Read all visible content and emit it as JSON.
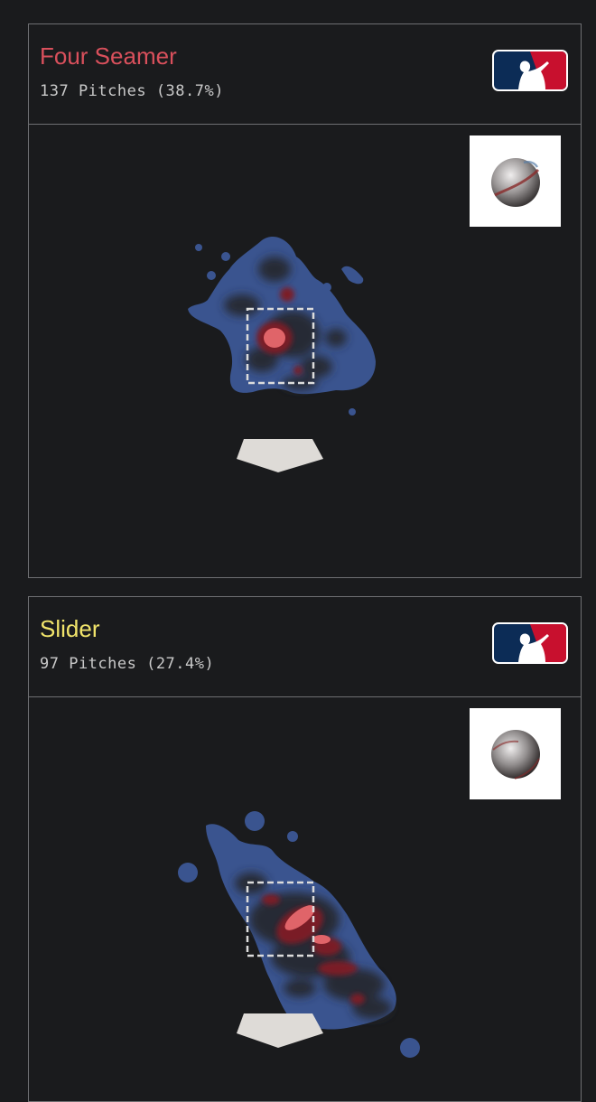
{
  "cards": [
    {
      "pitch_name": "Four Seamer",
      "pitch_count_text": "137 Pitches (38.7%)",
      "name_color": "#d9505c",
      "logo_icon": "mlb-logo-icon",
      "ball_icon": "four-seam-ball-icon"
    },
    {
      "pitch_name": "Slider",
      "pitch_count_text": "97 Pitches (27.4%)",
      "name_color": "#f2e56b",
      "logo_icon": "mlb-logo-icon",
      "ball_icon": "slider-ball-icon"
    }
  ],
  "colors": {
    "background": "#1a1b1d",
    "border": "#6e6f72",
    "heat_low": "#3a548f",
    "heat_mid": "#262a36",
    "heat_high": "#7a1f26",
    "heat_peak": "#e06469",
    "strike_zone": "#dcdcdc",
    "home_plate": "#dedbd7"
  }
}
